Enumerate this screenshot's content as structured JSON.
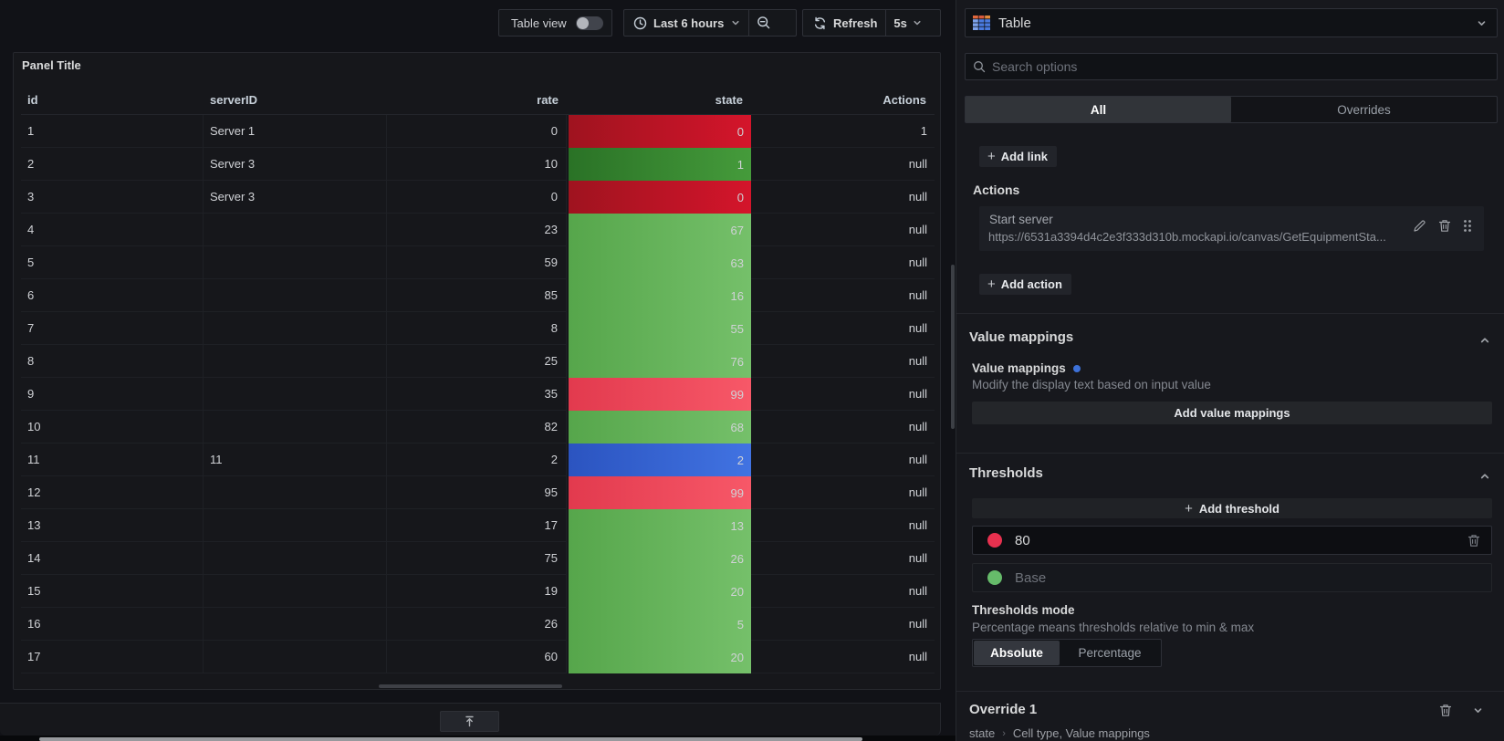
{
  "toolbar": {
    "table_view_label": "Table view",
    "time_range_label": "Last 6 hours",
    "refresh_label": "Refresh",
    "refresh_interval": "5s"
  },
  "panel": {
    "title": "Panel Title"
  },
  "table": {
    "columns": [
      "id",
      "serverID",
      "rate",
      "state",
      "Actions"
    ],
    "rows": [
      {
        "id": "1",
        "serverID": "Server 1",
        "rate": "0",
        "state": "0",
        "actions": "1",
        "state_color": "dark-red"
      },
      {
        "id": "2",
        "serverID": "Server 3",
        "rate": "10",
        "state": "1",
        "actions": "null",
        "state_color": "dark-green"
      },
      {
        "id": "3",
        "serverID": "Server 3",
        "rate": "0",
        "state": "0",
        "actions": "null",
        "state_color": "dark-red"
      },
      {
        "id": "4",
        "serverID": "",
        "rate": "23",
        "state": "67",
        "actions": "null",
        "state_color": "green"
      },
      {
        "id": "5",
        "serverID": "",
        "rate": "59",
        "state": "63",
        "actions": "null",
        "state_color": "green"
      },
      {
        "id": "6",
        "serverID": "",
        "rate": "85",
        "state": "16",
        "actions": "null",
        "state_color": "green"
      },
      {
        "id": "7",
        "serverID": "",
        "rate": "8",
        "state": "55",
        "actions": "null",
        "state_color": "green"
      },
      {
        "id": "8",
        "serverID": "",
        "rate": "25",
        "state": "76",
        "actions": "null",
        "state_color": "green"
      },
      {
        "id": "9",
        "serverID": "",
        "rate": "35",
        "state": "99",
        "actions": "null",
        "state_color": "red"
      },
      {
        "id": "10",
        "serverID": "",
        "rate": "82",
        "state": "68",
        "actions": "null",
        "state_color": "green"
      },
      {
        "id": "11",
        "serverID": "11",
        "rate": "2",
        "state": "2",
        "actions": "null",
        "state_color": "blue"
      },
      {
        "id": "12",
        "serverID": "",
        "rate": "95",
        "state": "99",
        "actions": "null",
        "state_color": "red"
      },
      {
        "id": "13",
        "serverID": "",
        "rate": "17",
        "state": "13",
        "actions": "null",
        "state_color": "green"
      },
      {
        "id": "14",
        "serverID": "",
        "rate": "75",
        "state": "26",
        "actions": "null",
        "state_color": "green"
      },
      {
        "id": "15",
        "serverID": "",
        "rate": "19",
        "state": "20",
        "actions": "null",
        "state_color": "green"
      },
      {
        "id": "16",
        "serverID": "",
        "rate": "26",
        "state": "5",
        "actions": "null",
        "state_color": "green"
      },
      {
        "id": "17",
        "serverID": "",
        "rate": "60",
        "state": "20",
        "actions": "null",
        "state_color": "green"
      }
    ],
    "state_gradients": {
      "green": [
        "#56a64b",
        "#75c06a"
      ],
      "dark-green": [
        "#2a7226",
        "#459b3b"
      ],
      "red": [
        "#e23a4e",
        "#f75868"
      ],
      "dark-red": [
        "#9f131f",
        "#d4152b"
      ],
      "blue": [
        "#2b54c0",
        "#4173e2"
      ]
    }
  },
  "sidebar": {
    "viz_picker": {
      "label": "Table"
    },
    "search": {
      "placeholder": "Search options"
    },
    "tabs": {
      "all": "All",
      "overrides": "Overrides"
    },
    "add_link": {
      "plus": "+",
      "label": "Add link"
    },
    "actions_section": {
      "label": "Actions",
      "action_title": "Start server",
      "action_url": "https://6531a3394d4c2e3f333d310b.mockapi.io/canvas/GetEquipmentSta...",
      "add_action": {
        "plus": "+",
        "label": "Add action"
      }
    },
    "value_mappings": {
      "section_title": "Value mappings",
      "field_label": "Value mappings",
      "field_desc": "Modify the display text based on input value",
      "button_label": "Add value mappings"
    },
    "thresholds": {
      "section_title": "Thresholds",
      "add_button": {
        "plus": "+",
        "label": "Add threshold"
      },
      "items": [
        {
          "value": "80",
          "color": "#e8314f"
        },
        {
          "value": "Base",
          "color": "#66bb6a"
        }
      ],
      "mode_label": "Thresholds mode",
      "mode_desc": "Percentage means thresholds relative to min & max",
      "mode_options": {
        "absolute": "Absolute",
        "percentage": "Percentage"
      }
    },
    "override": {
      "title": "Override 1",
      "crumb_field": "state",
      "crumb_props": "Cell type, Value mappings"
    }
  }
}
